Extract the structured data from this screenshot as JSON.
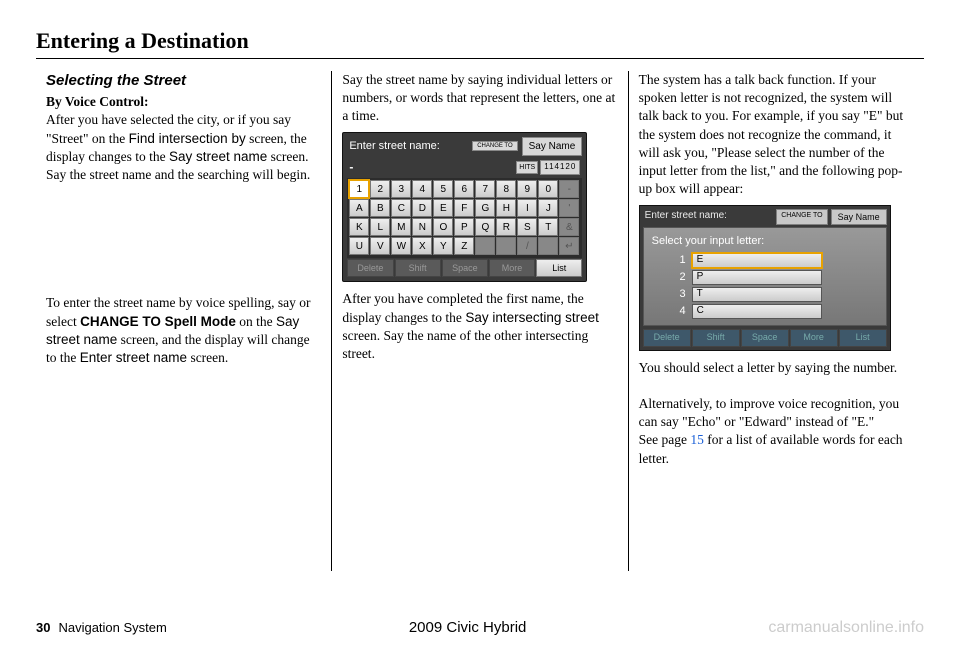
{
  "header": {
    "title": "Entering a Destination"
  },
  "col1": {
    "section_title": "Selecting the Street",
    "subhead": "By Voice Control:",
    "p1a": "After you have selected the city, or if you say \"Street\" on the ",
    "ui1": "Find intersection by",
    "p1b": " screen, the display changes to the ",
    "ui2": "Say street name",
    "p1c": " screen. Say the street name and the searching will begin.",
    "p2a": "To enter the street name by voice spelling, say or select ",
    "b1": "CHANGE TO Spell Mode",
    "p2b": " on the ",
    "ui3": "Say street name",
    "p2c": " screen, and the display will change to the ",
    "ui4": "Enter street name",
    "p2d": " screen."
  },
  "col2": {
    "p1": "Say the street name by saying individual letters or numbers, or words that represent the letters, one at a time.",
    "screen": {
      "header_label": "Enter street name:",
      "change_to": "CHANGE TO",
      "say_name": "Say Name",
      "hits_label": "HITS",
      "hits_value": "114120",
      "rows": [
        [
          "1",
          "2",
          "3",
          "4",
          "5",
          "6",
          "7",
          "8",
          "9",
          "0",
          "-"
        ],
        [
          "A",
          "B",
          "C",
          "D",
          "E",
          "F",
          "G",
          "H",
          "I",
          "J",
          "'"
        ],
        [
          "K",
          "L",
          "M",
          "N",
          "O",
          "P",
          "Q",
          "R",
          "S",
          "T",
          "&"
        ],
        [
          "U",
          "V",
          "W",
          "X",
          "Y",
          "Z",
          "",
          "",
          "/",
          "",
          ""
        ]
      ],
      "bottom": [
        "Delete",
        "Shift",
        "Space",
        "More",
        "List"
      ]
    },
    "p2a": "After you have completed the first name, the display changes to the ",
    "ui1": "Say intersecting street",
    "p2b": " screen. Say the name of the other intersecting street."
  },
  "col3": {
    "p1": "The system has a talk back function. If your spoken letter is not recognized, the system will talk back to you. For example, if you say \"E\" but the system does not recognize the command, it will ask you, \"Please select the number of the input letter from the list,\" and the following pop-up box will appear:",
    "popup": {
      "bg_label": "Enter street name:",
      "change_to": "CHANGE TO",
      "say_name": "Say Name",
      "title": "Select your input letter:",
      "options": [
        {
          "n": "1",
          "v": "E"
        },
        {
          "n": "2",
          "v": "P"
        },
        {
          "n": "3",
          "v": "T"
        },
        {
          "n": "4",
          "v": "C"
        }
      ],
      "bottom": [
        "Delete",
        "Shift",
        "Space",
        "More",
        "List"
      ]
    },
    "p2": "You should select a letter by saying the number.",
    "p3a": "Alternatively, to improve voice recognition, you can say \"Echo\" or \"Edward\" instead of \"E.\"",
    "p3b_a": "See page ",
    "p3b_link": "15",
    "p3b_b": " for a list of available words for each letter."
  },
  "footer": {
    "page_number": "30",
    "system_name": "Navigation System",
    "model": "2009  Civic  Hybrid",
    "watermark": "carmanualsonline.info"
  }
}
